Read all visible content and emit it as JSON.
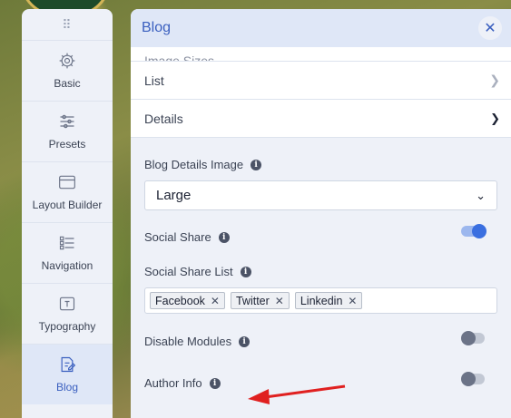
{
  "sidebar": {
    "drag_handle": "⠿",
    "items": [
      {
        "label": "Basic",
        "icon": "gear-icon"
      },
      {
        "label": "Presets",
        "icon": "sliders-icon"
      },
      {
        "label": "Layout Builder",
        "icon": "layout-icon"
      },
      {
        "label": "Navigation",
        "icon": "list-icon"
      },
      {
        "label": "Typography",
        "icon": "text-icon"
      },
      {
        "label": "Blog",
        "icon": "edit-icon",
        "active": true
      }
    ]
  },
  "panel": {
    "title": "Blog",
    "close": "✕",
    "rows": {
      "image_sizes": "Image Sizes",
      "list": "List",
      "details": "Details"
    },
    "details": {
      "blog_details_image_label": "Blog Details Image",
      "blog_details_image_value": "Large",
      "social_share_label": "Social Share",
      "social_share_on": true,
      "social_share_list_label": "Social Share List",
      "social_share_tags": [
        "Facebook",
        "Twitter",
        "Linkedin"
      ],
      "disable_modules_label": "Disable Modules",
      "disable_modules_on": false,
      "author_info_label": "Author Info",
      "author_info_on": false
    }
  },
  "colors": {
    "accent": "#3a5fbf",
    "toggle_on": "#3a6fe0",
    "annotation_arrow": "#e02020"
  }
}
